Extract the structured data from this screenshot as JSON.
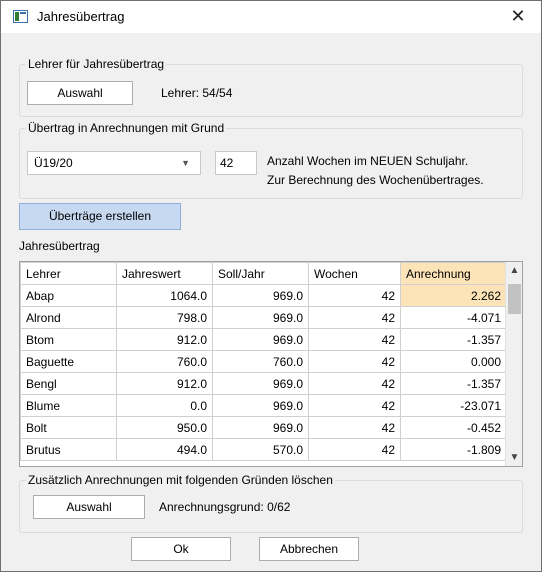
{
  "window": {
    "title": "Jahresübertrag",
    "close_glyph": "✕"
  },
  "group_teacher": {
    "legend": "Lehrer für Jahresübertrag",
    "button": "Auswahl",
    "status": "Lehrer: 54/54"
  },
  "group_carry": {
    "legend": "Übertrag in Anrechnungen mit Grund",
    "reason_value": "Ü19/20",
    "weeks_value": "42",
    "hint_line1": "Anzahl Wochen im NEUEN Schuljahr.",
    "hint_line2": "Zur Berechnung des Wochenübertrages."
  },
  "create_button": "Überträge erstellen",
  "table": {
    "caption": "Jahresübertrag",
    "columns": [
      "Lehrer",
      "Jahreswert",
      "Soll/Jahr",
      "Wochen",
      "Anrechnung"
    ],
    "rows": [
      [
        "Abap",
        "1064.0",
        "969.0",
        "42",
        "2.262"
      ],
      [
        "Alrond",
        "798.0",
        "969.0",
        "42",
        "-4.071"
      ],
      [
        "Btom",
        "912.0",
        "969.0",
        "42",
        "-1.357"
      ],
      [
        "Baguette",
        "760.0",
        "760.0",
        "42",
        "0.000"
      ],
      [
        "Bengl",
        "912.0",
        "969.0",
        "42",
        "-1.357"
      ],
      [
        "Blume",
        "0.0",
        "969.0",
        "42",
        "-23.071"
      ],
      [
        "Bolt",
        "950.0",
        "969.0",
        "42",
        "-0.452"
      ],
      [
        "Brutus",
        "494.0",
        "570.0",
        "42",
        "-1.809"
      ]
    ]
  },
  "group_delete": {
    "legend": "Zusätzlich Anrechnungen mit folgenden Gründen löschen",
    "button": "Auswahl",
    "status": "Anrechnungsgrund: 0/62"
  },
  "footer": {
    "ok": "Ok",
    "cancel": "Abbrechen"
  },
  "colors": {
    "highlight": "#fce4b8",
    "create_button_bg": "#c7d9f0"
  }
}
